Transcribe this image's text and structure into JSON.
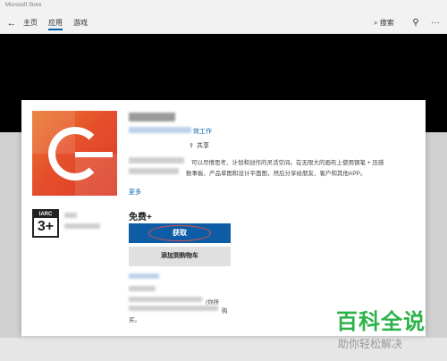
{
  "window": {
    "title": "Microsoft Store"
  },
  "nav": {
    "back_icon": "back-arrow-icon",
    "tabs": [
      {
        "label": "主页",
        "active": false
      },
      {
        "label": "应用",
        "active": true
      },
      {
        "label": "游戏",
        "active": false
      }
    ],
    "search_label": "搜索",
    "search_icon": "search-icon",
    "account_icon": "person-icon",
    "more_icon": "more-icon"
  },
  "app": {
    "category_link": "效工作",
    "share_label": "共享",
    "description_line1": "可以尽情思考、计划和创作的灵活空间。在无限大的画布上使用钢笔 + 压感",
    "description_line2": "数事板、产品草图和设计平面图，然后分享给朋友、客户和其他APP。",
    "more_link": "更多",
    "rating": {
      "org": "IARC",
      "age": "3+"
    },
    "price": "免费+",
    "get_button": "获取",
    "cart_button": "添加到购物车",
    "footer_fragment1": "(你所",
    "footer_fragment2": "购",
    "footer_fragment3": "买。"
  },
  "watermark": {
    "line1": "百科全说",
    "line2": "助你轻松解决"
  },
  "colors": {
    "accent": "#0e5ca6",
    "link": "#0063b1",
    "watermark": "#2db24a",
    "icon_orange": "#e6502c"
  }
}
